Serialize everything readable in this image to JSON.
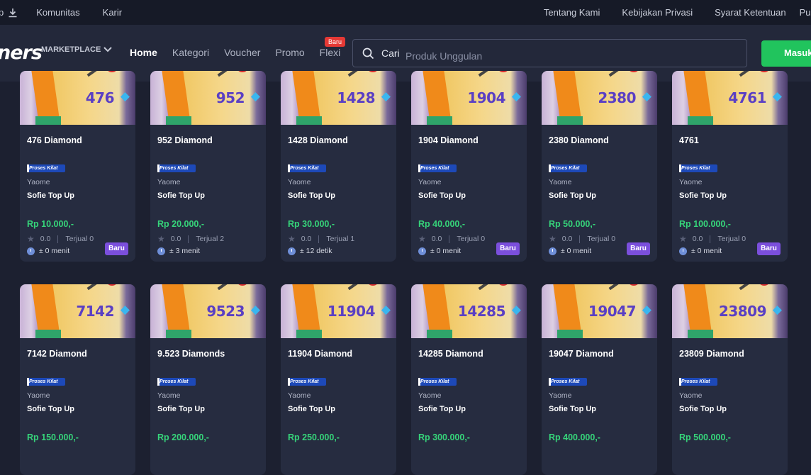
{
  "topbar": {
    "left_partial": "p",
    "left_links": [
      "Komunitas",
      "Karir"
    ],
    "right_links": [
      "Tentang Kami",
      "Kebijakan Privasi",
      "Syarat Ketentuan",
      "Pus"
    ]
  },
  "nav": {
    "logo_text": "ners",
    "marketplace_label": "MARKETPLACE",
    "links": [
      "Home",
      "Kategori",
      "Voucher",
      "Promo",
      "Flexi"
    ],
    "flexi_badge": "Baru",
    "search_button": "Cari",
    "search_placeholder": "Produk Unggulan",
    "login_label": "Masuk"
  },
  "badge_text": "Proses Kilat",
  "products": [
    {
      "thumb": "476",
      "title": "476 Diamond",
      "type": "Yaome",
      "seller": "Sofie Top Up",
      "price": "Rp 10.000,-",
      "rating": "0.0",
      "sold": "Terjual 0",
      "time": "± 0 menit",
      "is_new": true,
      "new_label": "Baru"
    },
    {
      "thumb": "952",
      "title": "952 Diamond",
      "type": "Yaome",
      "seller": "Sofie Top Up",
      "price": "Rp 20.000,-",
      "rating": "0.0",
      "sold": "Terjual 2",
      "time": "± 3 menit",
      "is_new": false,
      "new_label": ""
    },
    {
      "thumb": "1428",
      "title": "1428 Diamond",
      "type": "Yaome",
      "seller": "Sofie Top Up",
      "price": "Rp 30.000,-",
      "rating": "0.0",
      "sold": "Terjual 1",
      "time": "± 12 detik",
      "is_new": false,
      "new_label": ""
    },
    {
      "thumb": "1904",
      "title": "1904 Diamond",
      "type": "Yaome",
      "seller": "Sofie Top Up",
      "price": "Rp 40.000,-",
      "rating": "0.0",
      "sold": "Terjual 0",
      "time": "± 0 menit",
      "is_new": true,
      "new_label": "Baru"
    },
    {
      "thumb": "2380",
      "title": "2380 Diamond",
      "type": "Yaome",
      "seller": "Sofie Top Up",
      "price": "Rp 50.000,-",
      "rating": "0.0",
      "sold": "Terjual 0",
      "time": "± 0 menit",
      "is_new": true,
      "new_label": "Baru"
    },
    {
      "thumb": "4761",
      "title": "4761",
      "type": "Yaome",
      "seller": "Sofie Top Up",
      "price": "Rp 100.000,-",
      "rating": "0.0",
      "sold": "Terjual 0",
      "time": "± 0 menit",
      "is_new": true,
      "new_label": "Baru"
    },
    {
      "thumb": "7142",
      "title": "7142 Diamond",
      "type": "Yaome",
      "seller": "Sofie Top Up",
      "price": "Rp 150.000,-"
    },
    {
      "thumb": "9523",
      "title": "9.523 Diamonds",
      "type": "Yaome",
      "seller": "Sofie Top Up",
      "price": "Rp 200.000,-"
    },
    {
      "thumb": "11904",
      "title": "11904 Diamond",
      "type": "Yaome",
      "seller": "Sofie Top Up",
      "price": "Rp 250.000,-"
    },
    {
      "thumb": "14285",
      "title": "14285 Diamond",
      "type": "Yaome",
      "seller": "Sofie Top Up",
      "price": "Rp 300.000,-"
    },
    {
      "thumb": "19047",
      "title": "19047 Diamond",
      "type": "Yaome",
      "seller": "Sofie Top Up",
      "price": "Rp 400.000,-"
    },
    {
      "thumb": "23809",
      "title": "23809 Diamond",
      "type": "Yaome",
      "seller": "Sofie Top Up",
      "price": "Rp 500.000,-"
    }
  ],
  "colors": {
    "bg": "#1c2030",
    "card": "#262c40",
    "price": "#36d47a",
    "login": "#21c45d",
    "new_badge": "#7b4fdc"
  }
}
